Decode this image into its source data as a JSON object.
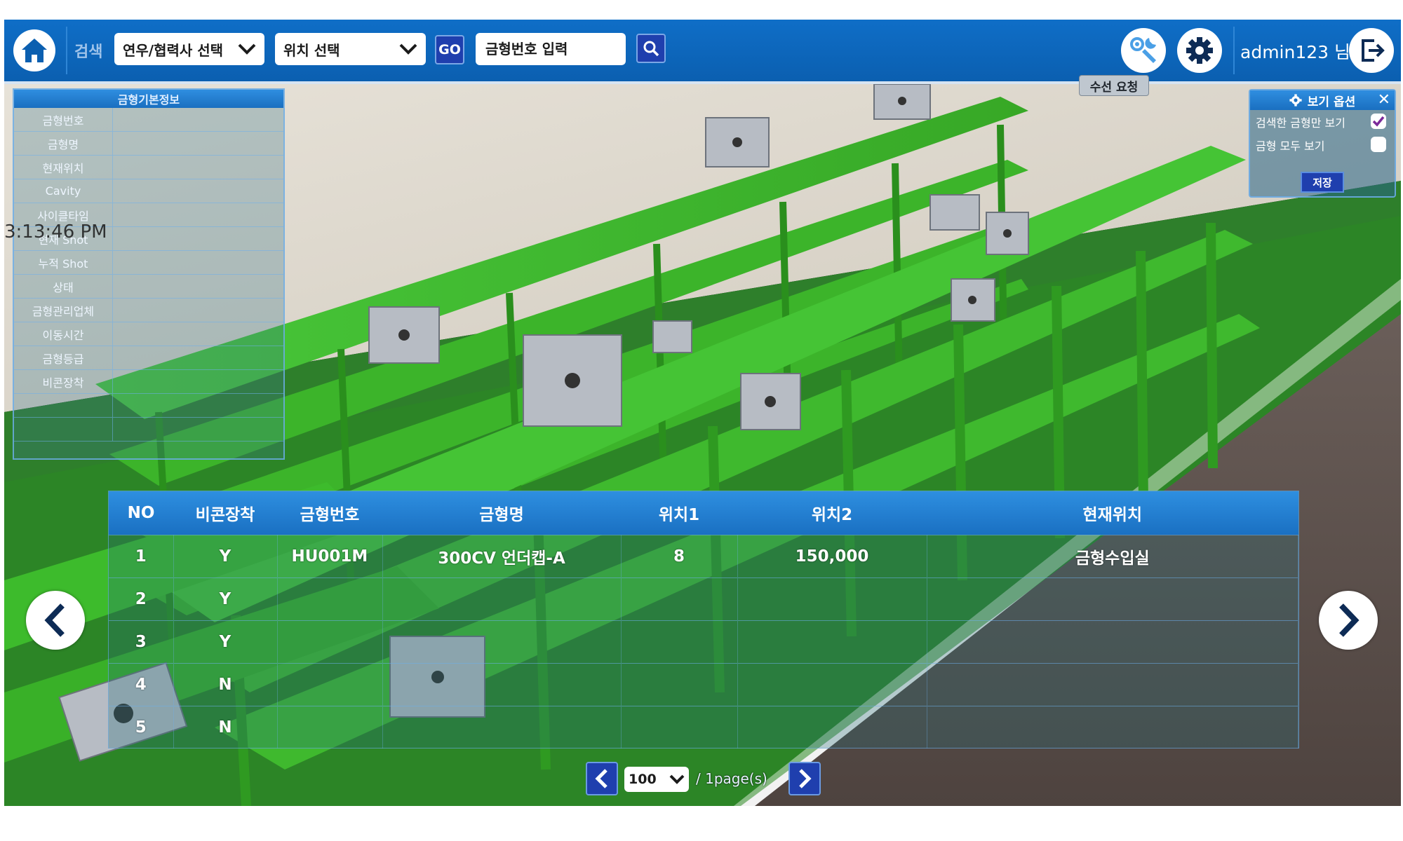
{
  "header": {
    "search_label": "검색",
    "partner_select": "연우/협력사 선택",
    "location_select": "위치 선택",
    "go_label": "GO",
    "mold_placeholder": "금형번호 입력",
    "user_name": "admin123 님",
    "repair_tooltip": "수선 요청",
    "icons": [
      "home-icon",
      "chevron-down-icon",
      "search-icon",
      "wrench-gear-icon",
      "gear-icon",
      "logout-icon"
    ]
  },
  "info_panel": {
    "title": "금형기본정보",
    "fields": [
      "금형번호",
      "금형명",
      "현재위치",
      "Cavity",
      "사이클타임",
      "현재 Shot",
      "누적 Shot",
      "상태",
      "금형관리업체",
      "이동시간",
      "금형등급",
      "비콘장착",
      "",
      ""
    ]
  },
  "clock": "3:13:46 PM",
  "options_panel": {
    "title": "보기 옵션",
    "close": "✕",
    "option1": "검색한 금형만 보기",
    "option1_checked": true,
    "option2": "금형 모두 보기",
    "option2_checked": false,
    "save": "저장"
  },
  "table": {
    "headers": [
      "NO",
      "비콘장착",
      "금형번호",
      "금형명",
      "위치1",
      "위치2",
      "현재위치"
    ],
    "rows": [
      [
        "1",
        "Y",
        "HU001M",
        "300CV 언더캡-A",
        "8",
        "150,000",
        "금형수입실"
      ],
      [
        "2",
        "Y",
        "",
        "",
        "",
        "",
        ""
      ],
      [
        "3",
        "Y",
        "",
        "",
        "",
        "",
        ""
      ],
      [
        "4",
        "N",
        "",
        "",
        "",
        "",
        ""
      ],
      [
        "5",
        "N",
        "",
        "",
        "",
        "",
        ""
      ]
    ]
  },
  "pager": {
    "page_size": "100",
    "page_count": "/ 1page(s)"
  },
  "colors": {
    "topbar": "#0b5fb0",
    "button_blue": "#1f3fae",
    "shelf_green": "#3db52a",
    "floor": "#5a4d49"
  }
}
